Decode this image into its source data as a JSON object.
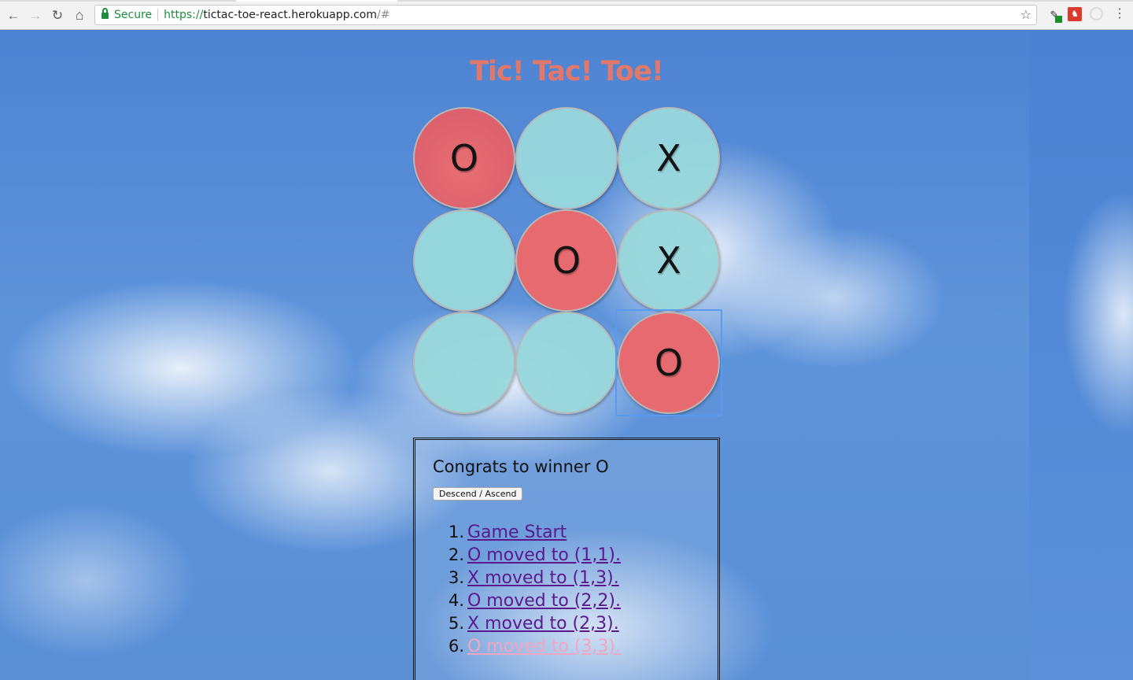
{
  "browser": {
    "secure_label": "Secure",
    "url_scheme": "https://",
    "url_host": "tictac-toe-react.herokuapp.com",
    "url_rest": "/#"
  },
  "page": {
    "title": "Tic! Tac! Toe!",
    "board": [
      [
        "O",
        "",
        "X"
      ],
      [
        "",
        "O",
        "X"
      ],
      [
        "",
        "",
        "O"
      ]
    ],
    "status": "Congrats to winner O",
    "sort_button": "Descend / Ascend",
    "moves": [
      {
        "num": "1.",
        "label": "Game Start"
      },
      {
        "num": "2.",
        "label": "O moved to (1,1)."
      },
      {
        "num": "3.",
        "label": "X moved to (1,3)."
      },
      {
        "num": "4.",
        "label": "O moved to (2,2)."
      },
      {
        "num": "5.",
        "label": "X moved to (2,3)."
      },
      {
        "num": "6.",
        "label": "O moved to (3,3)."
      }
    ]
  },
  "colors": {
    "title": "#e0786c",
    "o_cell": "#e66a6f",
    "x_cell": "#98d7dc",
    "link": "#5a1a8c",
    "current_link": "#f2a6c0",
    "secure": "#1e8e3e"
  }
}
